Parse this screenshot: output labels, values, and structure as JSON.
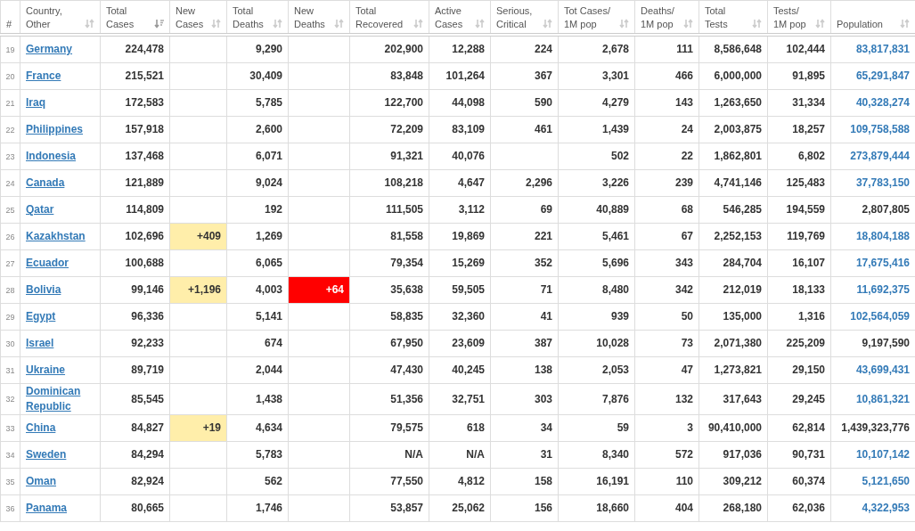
{
  "table": {
    "columns": [
      {
        "kind": "index",
        "lines": [
          "#"
        ]
      },
      {
        "kind": "country",
        "lines": [
          "Country,",
          "Other"
        ],
        "sorted": false
      },
      {
        "kind": "number",
        "lines": [
          "Total",
          "Cases"
        ],
        "sorted": true
      },
      {
        "kind": "gain",
        "lines": [
          "New",
          "Cases"
        ],
        "sorted": false
      },
      {
        "kind": "number",
        "lines": [
          "Total",
          "Deaths"
        ],
        "sorted": false
      },
      {
        "kind": "alarm",
        "lines": [
          "New",
          "Deaths"
        ],
        "sorted": false
      },
      {
        "kind": "number",
        "lines": [
          "Total",
          "Recovered"
        ],
        "sorted": false
      },
      {
        "kind": "number",
        "lines": [
          "Active",
          "Cases"
        ],
        "sorted": false
      },
      {
        "kind": "number",
        "lines": [
          "Serious,",
          "Critical"
        ],
        "sorted": false
      },
      {
        "kind": "number",
        "lines": [
          "Tot Cases/",
          "1M pop"
        ],
        "sorted": false
      },
      {
        "kind": "number",
        "lines": [
          "Deaths/",
          "1M pop"
        ],
        "sorted": false
      },
      {
        "kind": "number",
        "lines": [
          "Total",
          "Tests"
        ],
        "sorted": false
      },
      {
        "kind": "number",
        "lines": [
          "Tests/",
          "1M pop"
        ],
        "sorted": false
      },
      {
        "kind": "population",
        "lines": [
          "Population"
        ],
        "sorted": false
      }
    ],
    "rows": [
      {
        "cells": [
          "19",
          "Germany",
          "224,478",
          null,
          "9,290",
          null,
          "202,900",
          "12,288",
          "224",
          "2,678",
          "111",
          "8,586,648",
          "102,444",
          "83,817,831"
        ],
        "population_link": true
      },
      {
        "cells": [
          "20",
          "France",
          "215,521",
          null,
          "30,409",
          null,
          "83,848",
          "101,264",
          "367",
          "3,301",
          "466",
          "6,000,000",
          "91,895",
          "65,291,847"
        ],
        "population_link": true
      },
      {
        "cells": [
          "21",
          "Iraq",
          "172,583",
          null,
          "5,785",
          null,
          "122,700",
          "44,098",
          "590",
          "4,279",
          "143",
          "1,263,650",
          "31,334",
          "40,328,274"
        ],
        "population_link": true
      },
      {
        "cells": [
          "22",
          "Philippines",
          "157,918",
          null,
          "2,600",
          null,
          "72,209",
          "83,109",
          "461",
          "1,439",
          "24",
          "2,003,875",
          "18,257",
          "109,758,588"
        ],
        "population_link": true
      },
      {
        "cells": [
          "23",
          "Indonesia",
          "137,468",
          null,
          "6,071",
          null,
          "91,321",
          "40,076",
          null,
          "502",
          "22",
          "1,862,801",
          "6,802",
          "273,879,444"
        ],
        "population_link": true
      },
      {
        "cells": [
          "24",
          "Canada",
          "121,889",
          null,
          "9,024",
          null,
          "108,218",
          "4,647",
          "2,296",
          "3,226",
          "239",
          "4,741,146",
          "125,483",
          "37,783,150"
        ],
        "population_link": true
      },
      {
        "cells": [
          "25",
          "Qatar",
          "114,809",
          null,
          "192",
          null,
          "111,505",
          "3,112",
          "69",
          "40,889",
          "68",
          "546,285",
          "194,559",
          "2,807,805"
        ],
        "population_link": false
      },
      {
        "cells": [
          "26",
          "Kazakhstan",
          "102,696",
          "+409",
          "1,269",
          null,
          "81,558",
          "19,869",
          "221",
          "5,461",
          "67",
          "2,252,153",
          "119,769",
          "18,804,188"
        ],
        "population_link": true
      },
      {
        "cells": [
          "27",
          "Ecuador",
          "100,688",
          null,
          "6,065",
          null,
          "79,354",
          "15,269",
          "352",
          "5,696",
          "343",
          "284,704",
          "16,107",
          "17,675,416"
        ],
        "population_link": true
      },
      {
        "cells": [
          "28",
          "Bolivia",
          "99,146",
          "+1,196",
          "4,003",
          "+64",
          "35,638",
          "59,505",
          "71",
          "8,480",
          "342",
          "212,019",
          "18,133",
          "11,692,375"
        ],
        "population_link": true
      },
      {
        "cells": [
          "29",
          "Egypt",
          "96,336",
          null,
          "5,141",
          null,
          "58,835",
          "32,360",
          "41",
          "939",
          "50",
          "135,000",
          "1,316",
          "102,564,059"
        ],
        "population_link": true
      },
      {
        "cells": [
          "30",
          "Israel",
          "92,233",
          null,
          "674",
          null,
          "67,950",
          "23,609",
          "387",
          "10,028",
          "73",
          "2,071,380",
          "225,209",
          "9,197,590"
        ],
        "population_link": false
      },
      {
        "cells": [
          "31",
          "Ukraine",
          "89,719",
          null,
          "2,044",
          null,
          "47,430",
          "40,245",
          "138",
          "2,053",
          "47",
          "1,273,821",
          "29,150",
          "43,699,431"
        ],
        "population_link": true
      },
      {
        "cells": [
          "32",
          "Dominican Republic",
          "85,545",
          null,
          "1,438",
          null,
          "51,356",
          "32,751",
          "303",
          "7,876",
          "132",
          "317,643",
          "29,245",
          "10,861,321"
        ],
        "population_link": true
      },
      {
        "cells": [
          "33",
          "China",
          "84,827",
          "+19",
          "4,634",
          null,
          "79,575",
          "618",
          "34",
          "59",
          "3",
          "90,410,000",
          "62,814",
          "1,439,323,776"
        ],
        "population_link": false
      },
      {
        "cells": [
          "34",
          "Sweden",
          "84,294",
          null,
          "5,783",
          null,
          "N/A",
          "N/A",
          "31",
          "8,340",
          "572",
          "917,036",
          "90,731",
          "10,107,142"
        ],
        "population_link": true
      },
      {
        "cells": [
          "35",
          "Oman",
          "82,924",
          null,
          "562",
          null,
          "77,550",
          "4,812",
          "158",
          "16,191",
          "110",
          "309,212",
          "60,374",
          "5,121,650"
        ],
        "population_link": true
      },
      {
        "cells": [
          "36",
          "Panama",
          "80,665",
          null,
          "1,746",
          null,
          "53,857",
          "25,062",
          "156",
          "18,660",
          "404",
          "268,180",
          "62,036",
          "4,322,953"
        ],
        "population_link": true
      }
    ]
  }
}
